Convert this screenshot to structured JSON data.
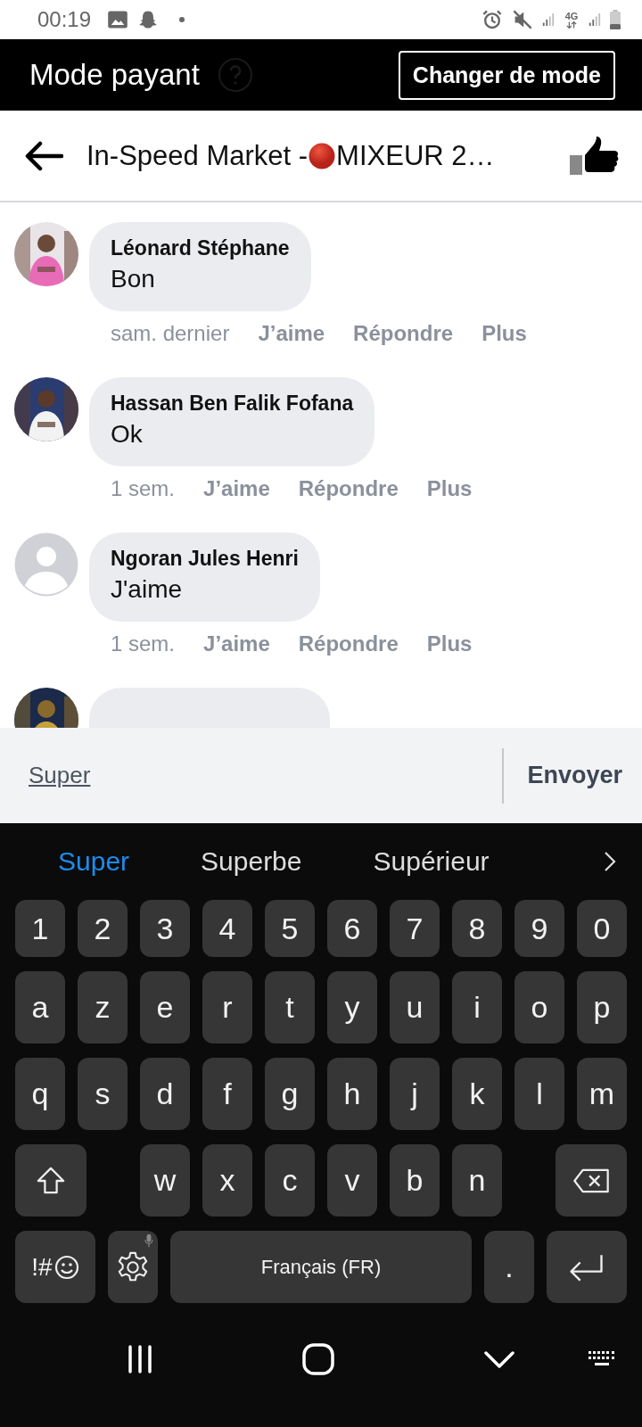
{
  "status_bar": {
    "time": "00:19",
    "network": "4G"
  },
  "header": {
    "title": "Mode payant",
    "button": "Changer de mode"
  },
  "post_bar": {
    "title_start": "In-Speed Market - ",
    "title_end": "MIXEUR 2…"
  },
  "comments": [
    {
      "kind": "comment",
      "author": "Léonard Stéphane",
      "text": "Bon",
      "time": "sam. dernier",
      "actions": [
        "J’aime",
        "Répondre",
        "Plus"
      ]
    },
    {
      "kind": "comment",
      "author": "Hassan Ben Falik Fofana",
      "text": "Ok",
      "time": "1 sem.",
      "actions": [
        "J’aime",
        "Répondre",
        "Plus"
      ]
    },
    {
      "kind": "comment",
      "author": "Ngoran Jules Henri",
      "text": "J'aime",
      "time": "1 sem.",
      "actions": [
        "J’aime",
        "Répondre",
        "Plus"
      ],
      "avatar": {
        "kind": "silhouette"
      }
    },
    {
      "kind": "partial"
    }
  ],
  "composer": {
    "value": "Super",
    "send": "Envoyer"
  },
  "keyboard": {
    "suggestions": [
      {
        "text": "Super",
        "selected": true
      },
      {
        "text": "Superbe",
        "selected": false
      },
      {
        "text": "Supérieur",
        "selected": false
      }
    ],
    "rows": [
      [
        {
          "kind": "char",
          "label": "1"
        },
        {
          "kind": "char",
          "label": "2"
        },
        {
          "kind": "char",
          "label": "3"
        },
        {
          "kind": "char",
          "label": "4"
        },
        {
          "kind": "char",
          "label": "5"
        },
        {
          "kind": "char",
          "label": "6"
        },
        {
          "kind": "char",
          "label": "7"
        },
        {
          "kind": "char",
          "label": "8"
        },
        {
          "kind": "char",
          "label": "9"
        },
        {
          "kind": "char",
          "label": "0"
        }
      ],
      [
        {
          "kind": "char",
          "label": "a"
        },
        {
          "kind": "char",
          "label": "z"
        },
        {
          "kind": "char",
          "label": "e"
        },
        {
          "kind": "char",
          "label": "r"
        },
        {
          "kind": "char",
          "label": "t"
        },
        {
          "kind": "char",
          "label": "y"
        },
        {
          "kind": "char",
          "label": "u"
        },
        {
          "kind": "char",
          "label": "i"
        },
        {
          "kind": "char",
          "label": "o"
        },
        {
          "kind": "char",
          "label": "p"
        }
      ],
      [
        {
          "kind": "char",
          "label": "q"
        },
        {
          "kind": "char",
          "label": "s"
        },
        {
          "kind": "char",
          "label": "d"
        },
        {
          "kind": "char",
          "label": "f"
        },
        {
          "kind": "char",
          "label": "g"
        },
        {
          "kind": "char",
          "label": "h"
        },
        {
          "kind": "char",
          "label": "j"
        },
        {
          "kind": "char",
          "label": "k"
        },
        {
          "kind": "char",
          "label": "l"
        },
        {
          "kind": "char",
          "label": "m"
        }
      ],
      [
        {
          "kind": "shift"
        },
        "",
        {
          "kind": "char",
          "label": "w"
        },
        {
          "kind": "char",
          "label": "x"
        },
        {
          "kind": "char",
          "label": "c"
        },
        {
          "kind": "char",
          "label": "v"
        },
        {
          "kind": "char",
          "label": "b"
        },
        {
          "kind": "char",
          "label": "n"
        },
        {
          "kind": "backspace"
        }
      ]
    ],
    "bottom_row": [
      {
        "kind": "symbols",
        "label": "!#"
      },
      {
        "kind": "settings"
      },
      {
        "kind": "space",
        "label": "Français (FR)"
      },
      {
        "kind": "char",
        "label": "."
      },
      {
        "kind": "enter"
      }
    ]
  }
}
